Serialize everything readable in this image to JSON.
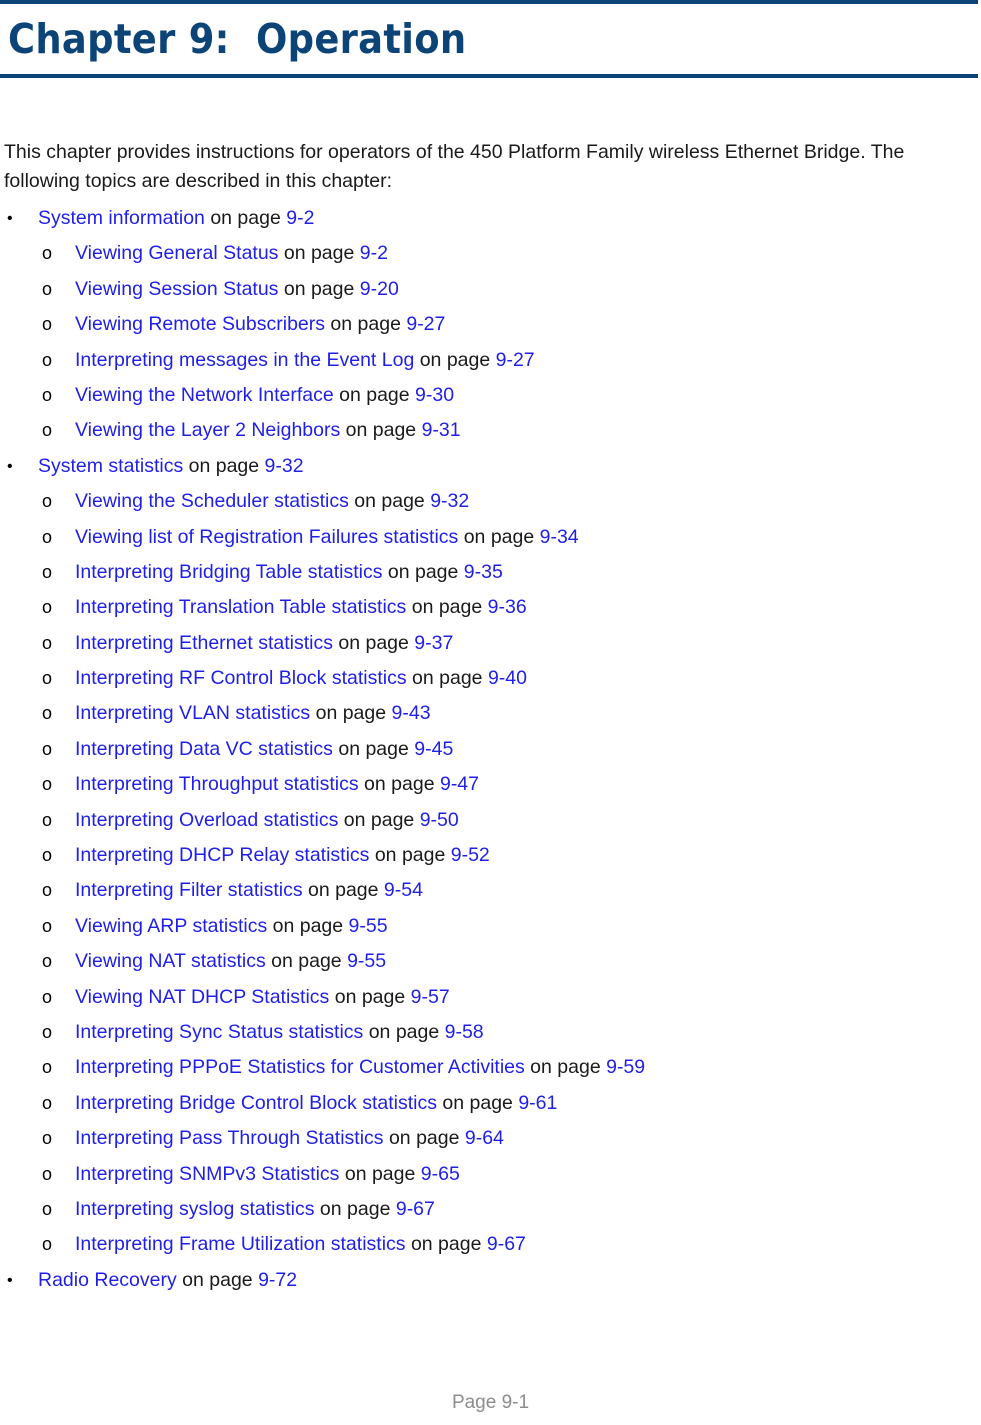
{
  "document": {
    "chapter_title": "Chapter 9:  Operation",
    "intro_paragraph": "This chapter provides instructions for operators of the 450 Platform Family wireless Ethernet Bridge. The following topics are described in this chapter:",
    "page_footer": "Page 9-1",
    "on_page_text": "on page",
    "bullet_glyph": "•",
    "sub_bullet_glyph": "o"
  },
  "colors": {
    "rule": "#0b4377",
    "title": "#0d4478",
    "link": "#1f1fe8",
    "body_text": "#1a1a1a",
    "footer_text": "#8c8c8c",
    "page_background": "#ffffff"
  },
  "toc": [
    {
      "level": 1,
      "title": "System information",
      "connector": " on page ",
      "page": "9-2"
    },
    {
      "level": 2,
      "title": "Viewing General Status",
      "connector": " on page ",
      "page": "9-2"
    },
    {
      "level": 2,
      "title": "Viewing Session Status",
      "connector": " on page ",
      "page": "9-20"
    },
    {
      "level": 2,
      "title": "Viewing Remote Subscribers",
      "connector": " on page ",
      "page": "9-27"
    },
    {
      "level": 2,
      "title": "Interpreting messages in the Event Log",
      "connector": " on page ",
      "page": "9-27"
    },
    {
      "level": 2,
      "title": "Viewing the Network Interface",
      "connector": " on page ",
      "page": "9-30"
    },
    {
      "level": 2,
      "title": "Viewing the Layer 2 Neighbors",
      "connector": " on page ",
      "page": "9-31"
    },
    {
      "level": 1,
      "title": "System statistics",
      "connector": " on page ",
      "page": "9-32"
    },
    {
      "level": 2,
      "title": "Viewing the Scheduler statistics",
      "connector": " on page ",
      "page": "9-32"
    },
    {
      "level": 2,
      "title": "Viewing list of Registration Failures statistics",
      "connector": " on page ",
      "page": "9-34"
    },
    {
      "level": 2,
      "title": "Interpreting Bridging Table statistics",
      "connector": " on page ",
      "page": "9-35"
    },
    {
      "level": 2,
      "title": "Interpreting Translation Table statistics",
      "connector": " on page ",
      "page": "9-36"
    },
    {
      "level": 2,
      "title": "Interpreting Ethernet statistics",
      "connector": " on page ",
      "page": "9-37"
    },
    {
      "level": 2,
      "title": "Interpreting RF Control Block statistics",
      "connector": " on page ",
      "page": "9-40"
    },
    {
      "level": 2,
      "title": "Interpreting VLAN statistics",
      "connector": " on page ",
      "page": "9-43"
    },
    {
      "level": 2,
      "title": "Interpreting Data VC statistics",
      "connector": " on page ",
      "page": "9-45"
    },
    {
      "level": 2,
      "title": "Interpreting Throughput statistics",
      "connector": " on page ",
      "page": "9-47"
    },
    {
      "level": 2,
      "title": "Interpreting Overload statistics",
      "connector": " on page ",
      "page": "9-50"
    },
    {
      "level": 2,
      "title": "Interpreting DHCP Relay statistics",
      "connector": " on page ",
      "page": "9-52"
    },
    {
      "level": 2,
      "title": "Interpreting Filter statistics",
      "connector": " on page ",
      "page": "9-54"
    },
    {
      "level": 2,
      "title": "Viewing ARP statistics",
      "connector": " on page ",
      "page": "9-55"
    },
    {
      "level": 2,
      "title": "Viewing NAT statistics",
      "connector": " on page ",
      "page": "9-55"
    },
    {
      "level": 2,
      "title": "Viewing NAT DHCP Statistics",
      "connector": " on page ",
      "page": "9-57"
    },
    {
      "level": 2,
      "title": "Interpreting Sync Status statistics",
      "connector": " on page ",
      "page": "9-58"
    },
    {
      "level": 2,
      "title": "Interpreting PPPoE Statistics for Customer Activities",
      "connector": " on page ",
      "page": "9-59"
    },
    {
      "level": 2,
      "title": "Interpreting Bridge Control Block statistics",
      "connector": " on page ",
      "page": "9-61"
    },
    {
      "level": 2,
      "title": "Interpreting Pass Through Statistics",
      "connector": " on page ",
      "page": "9-64"
    },
    {
      "level": 2,
      "title": "Interpreting SNMPv3 Statistics",
      "connector": " on page ",
      "page": "9-65"
    },
    {
      "level": 2,
      "title": "Interpreting syslog statistics",
      "connector": " on page ",
      "page": "9-67"
    },
    {
      "level": 2,
      "title": "Interpreting Frame Utilization statistics",
      "connector": " on page ",
      "page": "9-67"
    },
    {
      "level": 1,
      "title": "Radio Recovery ",
      "connector": " on page ",
      "page": "9-72"
    }
  ]
}
